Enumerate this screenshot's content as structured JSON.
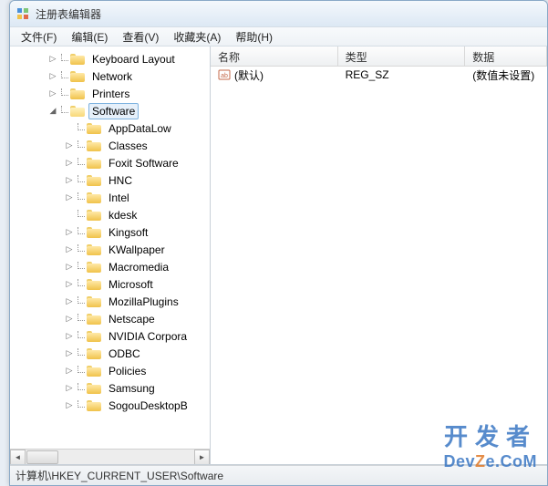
{
  "window": {
    "title": "注册表编辑器"
  },
  "menubar": {
    "items": [
      {
        "label": "文件(F)"
      },
      {
        "label": "编辑(E)"
      },
      {
        "label": "查看(V)"
      },
      {
        "label": "收藏夹(A)"
      },
      {
        "label": "帮助(H)"
      }
    ]
  },
  "tree": {
    "root_items": [
      {
        "label": "Keyboard Layout",
        "indent": 2,
        "expander": "▷"
      },
      {
        "label": "Network",
        "indent": 2,
        "expander": "▷"
      },
      {
        "label": "Printers",
        "indent": 2,
        "expander": "▷"
      },
      {
        "label": "Software",
        "indent": 2,
        "expander": "◢",
        "selected": true,
        "open": true
      }
    ],
    "software_children": [
      {
        "label": "AppDataLow"
      },
      {
        "label": "Classes",
        "expander": "▷"
      },
      {
        "label": "Foxit Software",
        "expander": "▷"
      },
      {
        "label": "HNC",
        "expander": "▷"
      },
      {
        "label": "Intel",
        "expander": "▷"
      },
      {
        "label": "kdesk"
      },
      {
        "label": "Kingsoft",
        "expander": "▷"
      },
      {
        "label": "KWallpaper",
        "expander": "▷"
      },
      {
        "label": "Macromedia",
        "expander": "▷"
      },
      {
        "label": "Microsoft",
        "expander": "▷"
      },
      {
        "label": "MozillaPlugins",
        "expander": "▷"
      },
      {
        "label": "Netscape",
        "expander": "▷"
      },
      {
        "label": "NVIDIA Corpora",
        "expander": "▷"
      },
      {
        "label": "ODBC",
        "expander": "▷"
      },
      {
        "label": "Policies",
        "expander": "▷"
      },
      {
        "label": "Samsung",
        "expander": "▷"
      },
      {
        "label": "SogouDesktopB",
        "expander": "▷"
      }
    ]
  },
  "list": {
    "columns": {
      "name": "名称",
      "type": "类型",
      "data": "数据"
    },
    "col_widths": {
      "name": 140,
      "type": 140,
      "data": 90
    },
    "rows": [
      {
        "name": "(默认)",
        "type": "REG_SZ",
        "data": "(数值未设置)"
      }
    ]
  },
  "statusbar": {
    "path": "计算机\\HKEY_CURRENT_USER\\Software"
  },
  "watermark": {
    "line1": "开发者",
    "line2_pre": "Dev",
    "line2_z": "Z",
    "line2_post": "e.CoM"
  }
}
